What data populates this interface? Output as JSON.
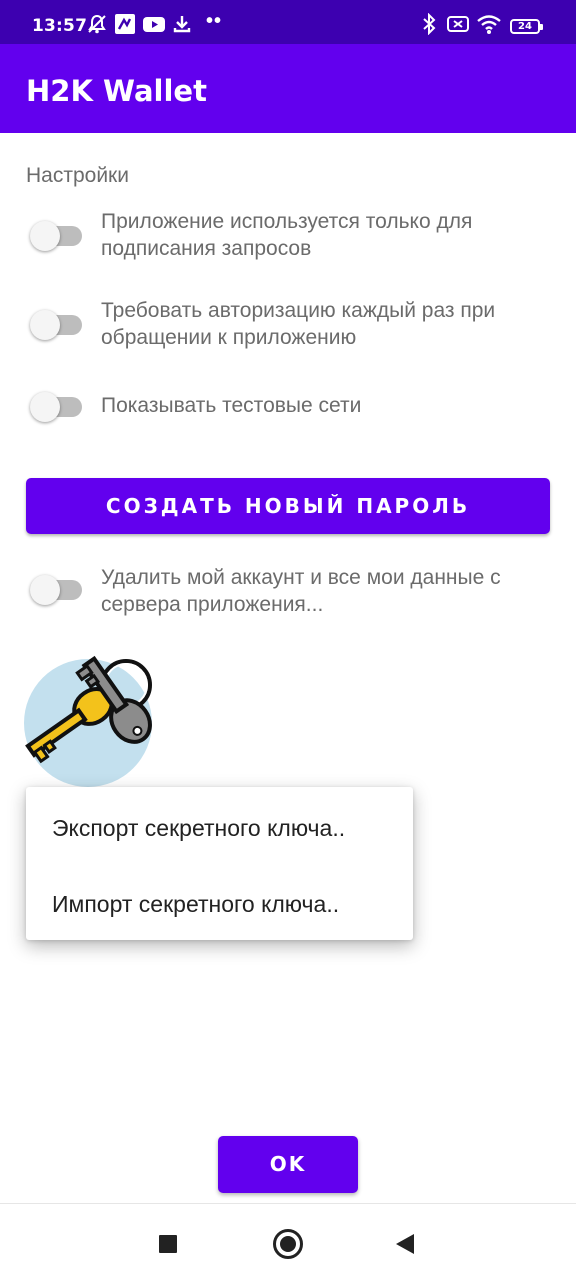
{
  "status_bar": {
    "time": "13:57",
    "dots": "••",
    "battery": "24",
    "left_icons": [
      "notifications-off-icon",
      "app-icon",
      "youtube-icon",
      "download-icon"
    ],
    "right_icons": [
      "bluetooth-icon",
      "sim-icon",
      "wifi-icon",
      "battery-icon"
    ]
  },
  "app_bar": {
    "title": "H2K Wallet",
    "color": "#6200ee"
  },
  "settings": {
    "title": "Настройки",
    "items": [
      {
        "label": "Приложение используется только для подписания запросов",
        "enabled": false
      },
      {
        "label": "Требовать авторизацию каждый раз при обращении к приложению",
        "enabled": false
      },
      {
        "label": "Показывать тестовые сети",
        "enabled": false
      }
    ]
  },
  "create_password_button": "СОЗДАТЬ НОВЫЙ ПАРОЛЬ",
  "delete_account": {
    "label": "Удалить мой аккаунт и все мои данные с сервера приложения...",
    "enabled": false
  },
  "key_image": {
    "icon": "keys-icon"
  },
  "popup_menu": {
    "items": [
      {
        "label": "Экспорт секретного ключа.."
      },
      {
        "label": "Импорт секретного ключа.."
      }
    ]
  },
  "ok_button": "OK",
  "nav_bar": {
    "icons": [
      "recents-icon",
      "home-icon",
      "back-icon"
    ]
  },
  "colors": {
    "accent": "#6200ee",
    "status_bar": "#3d00b0"
  }
}
